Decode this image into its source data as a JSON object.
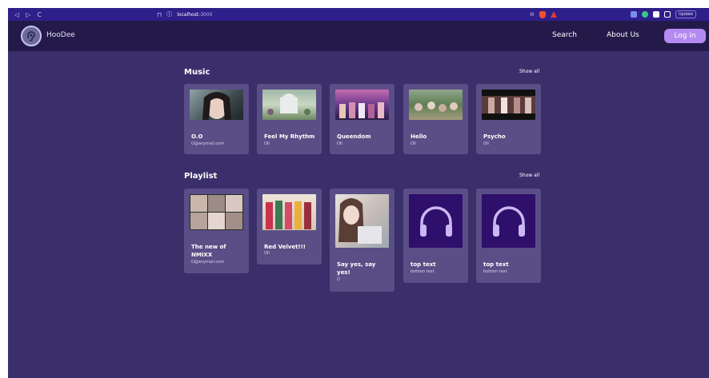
{
  "browser": {
    "nav_back": "◁",
    "nav_forward": "▷",
    "nav_reload": "C",
    "url_host": "localhost",
    "url_port": ":3000",
    "zoom_icon": "⊖",
    "update_label": "Update"
  },
  "header": {
    "logo_text": "HooDee",
    "nav": {
      "search": "Search",
      "about": "About Us"
    },
    "login_label": "Log in"
  },
  "music": {
    "title": "Music",
    "show_all": "Show all",
    "items": [
      {
        "title": "O.O",
        "sub": "O@anymail.com"
      },
      {
        "title": "Feel My Rhythm",
        "sub": "OII"
      },
      {
        "title": "Queendom",
        "sub": "OII"
      },
      {
        "title": "Hello",
        "sub": "OII"
      },
      {
        "title": "Psycho",
        "sub": "OII"
      }
    ]
  },
  "playlist": {
    "title": "Playlist",
    "show_all": "Show all",
    "items": [
      {
        "title": "The new of NMIXX",
        "sub": "O@anymail.com"
      },
      {
        "title": "Red Velvet!!!",
        "sub": "OII"
      },
      {
        "title": "Say yes, say yes!",
        "sub": "O"
      },
      {
        "title": "top text",
        "sub": "bottom text"
      },
      {
        "title": "top text",
        "sub": "bottom text"
      }
    ]
  },
  "colors": {
    "browser_bar": "#2f1f8a",
    "header_bg": "#241a4a",
    "page_bg": "#3b2f6b",
    "card_bg": "#5a4e86",
    "login_bg": "#b48bf0",
    "headphone_bg": "#2e0f6b",
    "headphone_fg": "#c9b8f2"
  }
}
